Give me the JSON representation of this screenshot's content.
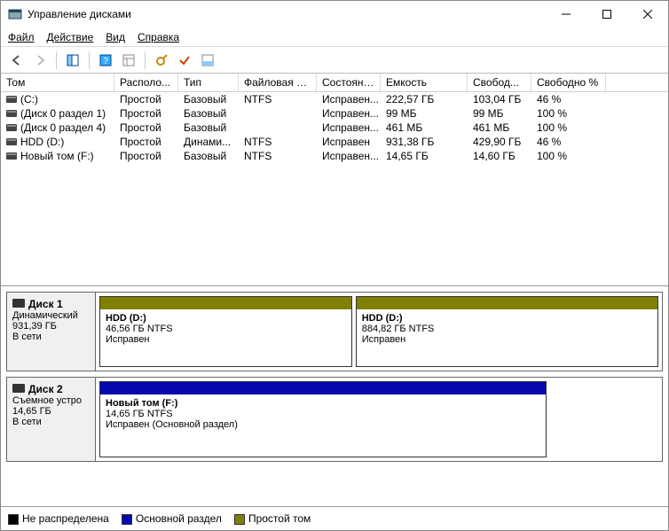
{
  "window": {
    "title": "Управление дисками"
  },
  "menu": {
    "file": "Файл",
    "action": "Действие",
    "view": "Вид",
    "help": "Справка"
  },
  "columns": {
    "volume": "Том",
    "layout": "Располо...",
    "type": "Тип",
    "fs": "Файловая с...",
    "status": "Состояние",
    "capacity": "Емкость",
    "free": "Свобод...",
    "pct": "Свободно %"
  },
  "volumes": [
    {
      "name": "(C:)",
      "layout": "Простой",
      "type": "Базовый",
      "fs": "NTFS",
      "status": "Исправен...",
      "capacity": "222,57 ГБ",
      "free": "103,04 ГБ",
      "pct": "46 %"
    },
    {
      "name": "(Диск 0 раздел 1)",
      "layout": "Простой",
      "type": "Базовый",
      "fs": "",
      "status": "Исправен...",
      "capacity": "99 МБ",
      "free": "99 МБ",
      "pct": "100 %"
    },
    {
      "name": "(Диск 0 раздел 4)",
      "layout": "Простой",
      "type": "Базовый",
      "fs": "",
      "status": "Исправен...",
      "capacity": "461 МБ",
      "free": "461 МБ",
      "pct": "100 %"
    },
    {
      "name": "HDD (D:)",
      "layout": "Простой",
      "type": "Динами...",
      "fs": "NTFS",
      "status": "Исправен",
      "capacity": "931,38 ГБ",
      "free": "429,90 ГБ",
      "pct": "46 %"
    },
    {
      "name": "Новый том (F:)",
      "layout": "Простой",
      "type": "Базовый",
      "fs": "NTFS",
      "status": "Исправен...",
      "capacity": "14,65 ГБ",
      "free": "14,60 ГБ",
      "pct": "100 %"
    }
  ],
  "disks": {
    "disk1": {
      "label": "Диск 1",
      "type": "Динамический",
      "size": "931,39 ГБ",
      "status": "В сети",
      "parts": [
        {
          "name": "HDD  (D:)",
          "line2": "46,56 ГБ NTFS",
          "line3": "Исправен"
        },
        {
          "name": "HDD  (D:)",
          "line2": "884,82 ГБ NTFS",
          "line3": "Исправен"
        }
      ]
    },
    "disk2": {
      "label": "Диск 2",
      "type": "Съемное устро",
      "size": "14,65 ГБ",
      "status": "В сети",
      "parts": [
        {
          "name": "Новый том  (F:)",
          "line2": "14,65 ГБ NTFS",
          "line3": "Исправен (Основной раздел)"
        }
      ]
    }
  },
  "legend": {
    "unallocated": "Не распределена",
    "primary": "Основной раздел",
    "simple": "Простой том"
  }
}
